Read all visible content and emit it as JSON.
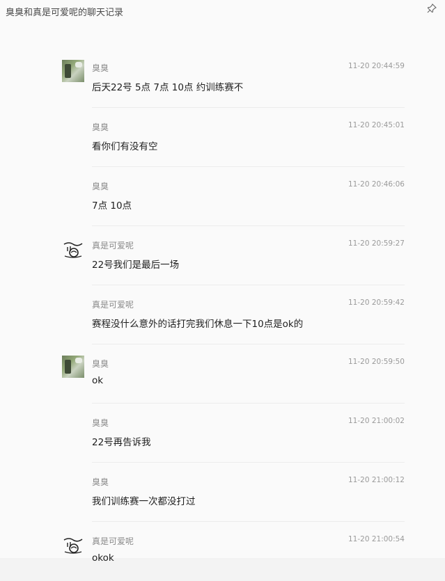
{
  "window": {
    "title": "臭臭和真是可爱呢的聊天记录",
    "pin_icon": "pin-icon"
  },
  "messages": [
    {
      "sender": "臭臭",
      "time": "11-20 20:44:59",
      "text": "后天22号 5点 7点 10点 约训练赛不",
      "avatar": "photo"
    },
    {
      "sender": "臭臭",
      "time": "11-20 20:45:01",
      "text": "看你们有没有空",
      "avatar": "none"
    },
    {
      "sender": "臭臭",
      "time": "11-20 20:46:06",
      "text": "7点 10点",
      "avatar": "none"
    },
    {
      "sender": "真是可爱呢",
      "time": "11-20 20:59:27",
      "text": "22号我们是最后一场",
      "avatar": "drawing"
    },
    {
      "sender": "真是可爱呢",
      "time": "11-20 20:59:42",
      "text": "赛程没什么意外的话打完我们休息一下10点是ok的",
      "avatar": "none"
    },
    {
      "sender": "臭臭",
      "time": "11-20 20:59:50",
      "text": "ok",
      "avatar": "photo"
    },
    {
      "sender": "臭臭",
      "time": "11-20 21:00:02",
      "text": "22号再告诉我",
      "avatar": "none"
    },
    {
      "sender": "臭臭",
      "time": "11-20 21:00:12",
      "text": "我们训练赛一次都没打过",
      "avatar": "none"
    },
    {
      "sender": "真是可爱呢",
      "time": "11-20 21:00:54",
      "text": "okok",
      "avatar": "drawing"
    }
  ]
}
